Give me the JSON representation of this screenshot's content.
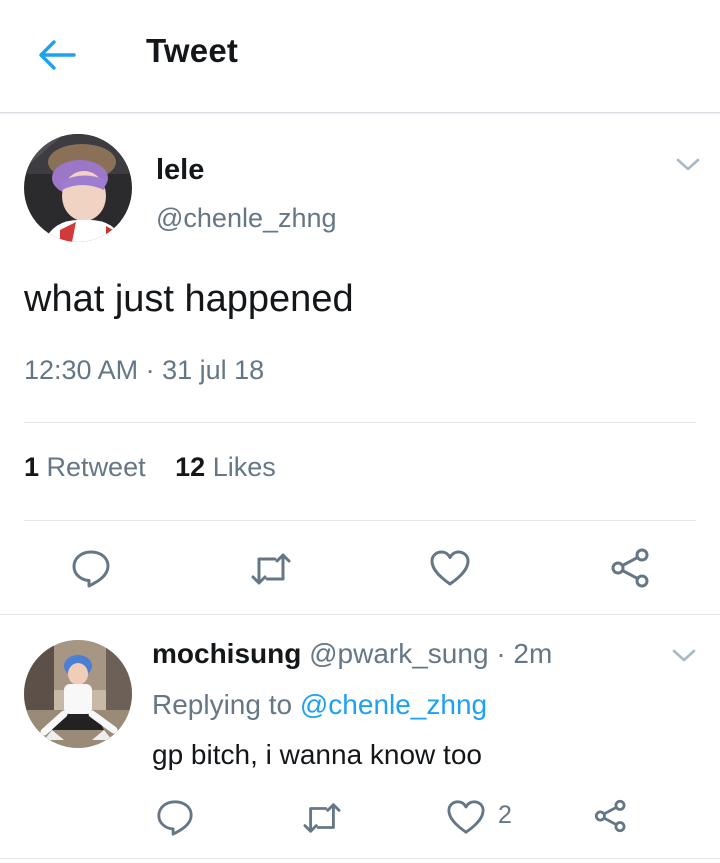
{
  "header": {
    "title": "Tweet",
    "back_icon": "arrow-left-icon",
    "accent": "#1da1f2"
  },
  "tweet": {
    "author_name": "lele",
    "author_handle": "@chenle_zhng",
    "text": "what just happened",
    "timestamp": "12:30 AM · 31 jul 18",
    "retweet_count": "1",
    "retweet_label": "Retweet",
    "like_count": "12",
    "like_label": "Likes",
    "actions": [
      "reply-icon",
      "retweet-icon",
      "like-icon",
      "share-icon"
    ]
  },
  "reply": {
    "author_name": "mochisung",
    "author_handle": "@pwark_sung",
    "separator": "·",
    "age": "2m",
    "replying_prefix": "Replying to",
    "replying_handle": "@chenle_zhng",
    "text": "gp bitch, i wanna know too",
    "like_count": "2"
  },
  "colors": {
    "text": "#14171a",
    "muted": "#657786",
    "link": "#1da1f2",
    "divider": "#e1e8ed"
  }
}
